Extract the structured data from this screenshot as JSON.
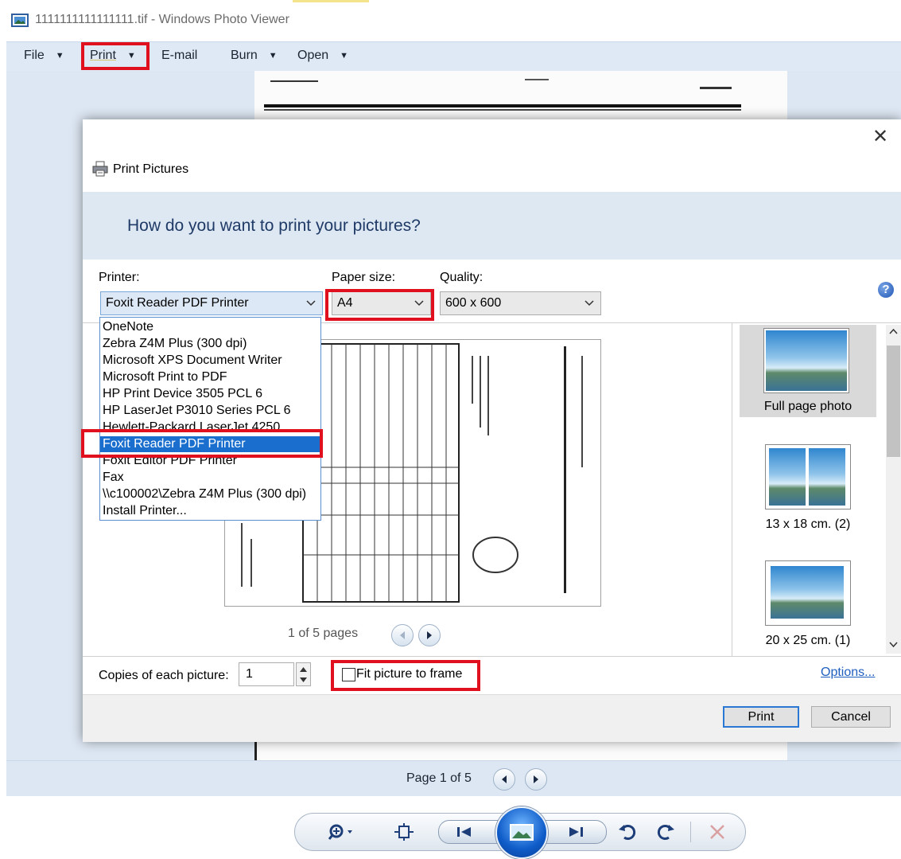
{
  "window": {
    "title": "1111111111111111.tif - Windows Photo Viewer"
  },
  "menu": {
    "file": "File",
    "print": "Print",
    "email": "E-mail",
    "burn": "Burn",
    "open": "Open"
  },
  "status": {
    "page_label": "Page 1 of 5"
  },
  "dialog": {
    "title": "Print Pictures",
    "question": "How do you want to print your pictures?",
    "printer_label": "Printer:",
    "paper_label": "Paper size:",
    "quality_label": "Quality:",
    "printer_value": "Foxit Reader PDF Printer",
    "paper_value": "A4",
    "quality_value": "600 x 600",
    "printers": [
      "OneNote",
      "Zebra Z4M Plus (300 dpi)",
      "Microsoft XPS Document Writer",
      "Microsoft Print to PDF",
      "HP Print Device 3505 PCL 6",
      "HP LaserJet P3010 Series PCL 6",
      "Hewlett-Packard LaserJet 4250",
      "Foxit Reader PDF Printer",
      "Foxit Editor PDF Printer",
      "Fax",
      "\\\\c100002\\Zebra Z4M Plus (300 dpi)",
      "Install Printer..."
    ],
    "pages_label": "1 of 5 pages",
    "layouts": [
      "Full page photo",
      "13 x 18 cm. (2)",
      "20 x 25 cm. (1)"
    ],
    "copies_label": "Copies of each picture:",
    "copies_value": "1",
    "fit_label": "Fit picture to frame",
    "fit_checked": false,
    "options_link": "Options...",
    "print_button": "Print",
    "cancel_button": "Cancel",
    "help_glyph": "?"
  },
  "colors": {
    "highlight": "#e0101e",
    "selection": "#1a6fce",
    "menubar": "#dfe9f5",
    "dialog_header": "#dde8f3"
  },
  "icons": {
    "close": "close-icon",
    "printer": "printer-icon",
    "help": "help-icon",
    "zoom": "zoom-icon",
    "fit": "actual-size-icon",
    "prev": "previous-icon",
    "slideshow": "slideshow-icon",
    "next": "next-icon",
    "rotate_ccw": "rotate-counterclockwise-icon",
    "rotate_cw": "rotate-clockwise-icon",
    "delete": "delete-icon"
  }
}
